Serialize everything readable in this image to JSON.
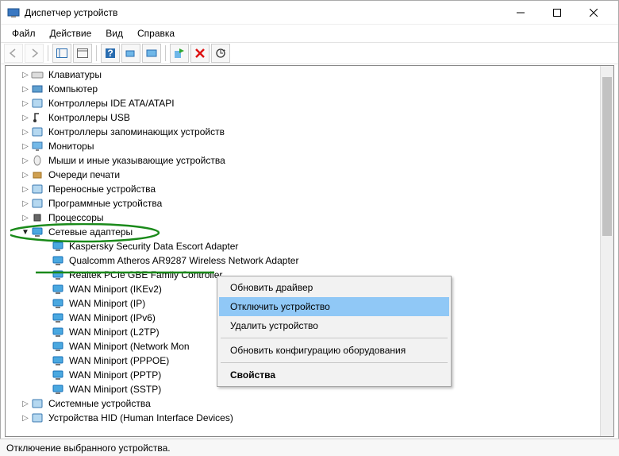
{
  "window": {
    "title": "Диспетчер устройств"
  },
  "menu": [
    "Файл",
    "Действие",
    "Вид",
    "Справка"
  ],
  "tree": {
    "items": [
      {
        "label": "Клавиатуры",
        "icon": "keyboard"
      },
      {
        "label": "Компьютер",
        "icon": "computer"
      },
      {
        "label": "Контроллеры IDE ATA/ATAPI",
        "icon": "ide"
      },
      {
        "label": "Контроллеры USB",
        "icon": "usb"
      },
      {
        "label": "Контроллеры запоминающих устройств",
        "icon": "storage"
      },
      {
        "label": "Мониторы",
        "icon": "monitor"
      },
      {
        "label": "Мыши и иные указывающие устройства",
        "icon": "mouse"
      },
      {
        "label": "Очереди печати",
        "icon": "printer"
      },
      {
        "label": "Переносные устройства",
        "icon": "portable"
      },
      {
        "label": "Программные устройства",
        "icon": "software"
      },
      {
        "label": "Процессоры",
        "icon": "cpu"
      }
    ],
    "network": {
      "label": "Сетевые адаптеры",
      "children": [
        "Kaspersky Security Data Escort Adapter",
        "Qualcomm Atheros AR9287 Wireless Network Adapter",
        "Realtek PCIe GBE Family Controller",
        "WAN Miniport (IKEv2)",
        "WAN Miniport (IP)",
        "WAN Miniport (IPv6)",
        "WAN Miniport (L2TP)",
        "WAN Miniport (Network Mon",
        "WAN Miniport (PPPOE)",
        "WAN Miniport (PPTP)",
        "WAN Miniport (SSTP)"
      ]
    },
    "after": [
      {
        "label": "Системные устройства",
        "icon": "system"
      },
      {
        "label": "Устройства HID (Human Interface Devices)",
        "icon": "hid"
      }
    ]
  },
  "context_menu": {
    "items": [
      "Обновить драйвер",
      "Отключить устройство",
      "Удалить устройство",
      "-",
      "Обновить конфигурацию оборудования",
      "-",
      "Свойства"
    ],
    "highlighted": "Отключить устройство"
  },
  "statusbar": "Отключение выбранного устройства."
}
